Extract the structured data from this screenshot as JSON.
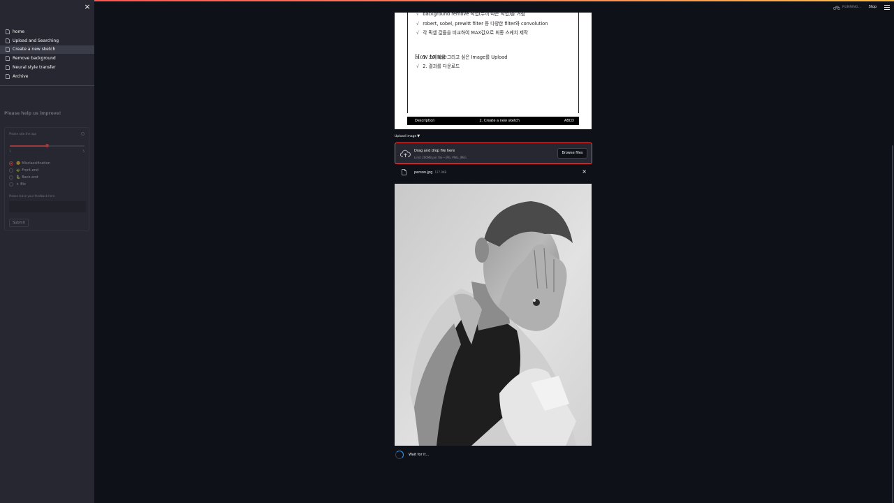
{
  "sidebar": {
    "close_label": "×",
    "nav": [
      "home",
      "Upload and Searching",
      "Create a new sketch",
      "Remove background",
      "Neural style transfer",
      "Archive"
    ],
    "active_index": 2,
    "help_heading": "Please help us improve!",
    "form": {
      "rate_label": "Please rate the app",
      "slider_min": "1",
      "slider_max": "5",
      "slider_value_fraction": 0.5,
      "radio_options": [
        {
          "emoji": "🙂",
          "label": "Misclassification"
        },
        {
          "emoji": "🐢",
          "label": "Front-end"
        },
        {
          "emoji": "🐍",
          "label": "Back-end"
        },
        {
          "emoji": "✦",
          "label": "Etc"
        }
      ],
      "radio_selected": 0,
      "feedback_label": "Please leave your feedback here",
      "submit_label": "Submit"
    }
  },
  "header": {
    "status": "RUNNING...",
    "stop_label": "Stop"
  },
  "document": {
    "lines": [
      "background remove 작업(누끼 따는 작업)을 거침",
      "robert, sobel, prewitt filter 등 다양한 filter와 convolution",
      "각 픽셀 값들을 비교하여 MAX값으로 최종 스케치 제작"
    ],
    "howto_heading": "How to use",
    "howto": [
      "1. 스케치를 그리고 싶은 Image를 Upload",
      "2. 결과를 다운로드"
    ],
    "check_mark": "√",
    "footer": {
      "left": "Description",
      "center": "2. Create a new sketch",
      "right": "ABCD"
    }
  },
  "uploader": {
    "label": "Upload image",
    "label_icon": "▼",
    "drop_title": "Drag and drop file here",
    "drop_sub": "Limit 200MB per file • JPG, PNG, JPEG",
    "browse_label": "Browse files",
    "file_name": "person.jpg",
    "file_size": "127.9KB",
    "remove_label": "×"
  },
  "status": {
    "wait_text": "Wait for it..."
  },
  "colors": {
    "accent": "#ff4b4b",
    "spinner": "#2b9bff",
    "background": "#0e1117",
    "sidebar": "#262730"
  }
}
